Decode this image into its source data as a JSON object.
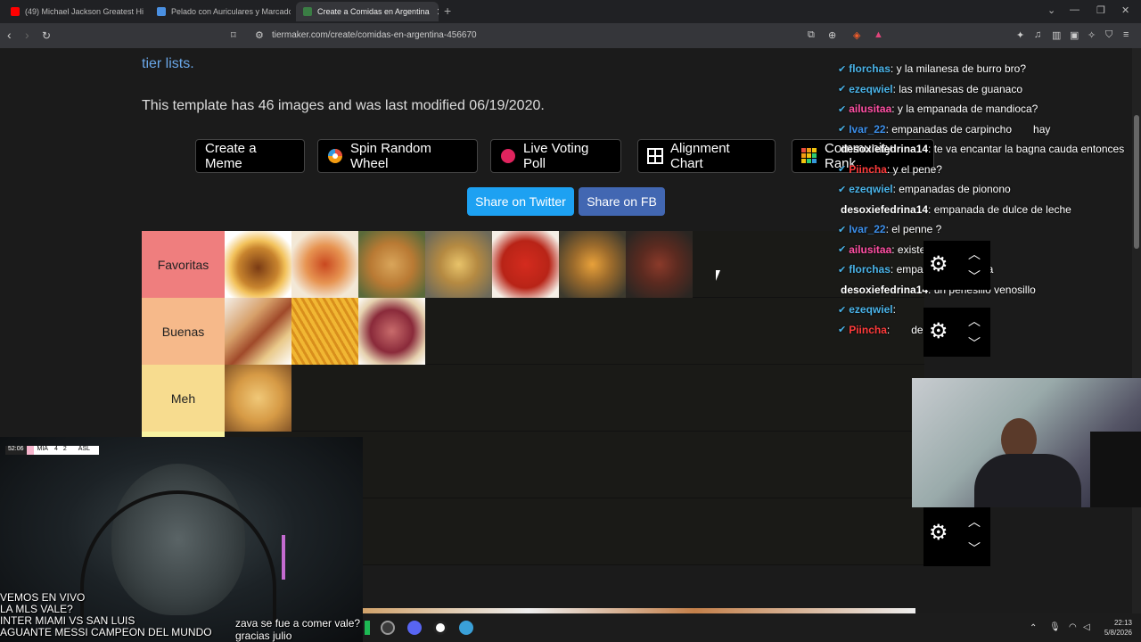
{
  "browser": {
    "tabs": [
      {
        "label": "(49) Michael Jackson Greatest Hi",
        "color": "#ff0000"
      },
      {
        "label": "Pelado con Auriculares y Marcador",
        "color": "#4a90e2"
      },
      {
        "label": "Create a Comidas en Argentina",
        "color": "#3a7d44"
      }
    ],
    "url": "tiermaker.com/create/comidas-en-argentina-456670"
  },
  "page": {
    "tier_lists_link": "tier lists.",
    "template_info": "This template has 46 images and was last modified 06/19/2020.",
    "buttons": [
      "Create a Meme",
      "Spin Random Wheel",
      "Live Voting Poll",
      "Alignment Chart",
      "Community Rank"
    ],
    "share_twitter": "Share on Twitter",
    "share_fb": "Share on FB",
    "tiers": [
      {
        "label": "Favoritas",
        "color": "#ef7e7e",
        "items": [
          "burger",
          "lasagna",
          "empanadas",
          "milanesa",
          "ravioles",
          "tacos",
          "asado"
        ]
      },
      {
        "label": "Buenas",
        "color": "#f6b98a",
        "items": [
          "pancho",
          "papas-fritas",
          "picada"
        ]
      },
      {
        "label": "Meh",
        "color": "#f7dc8f",
        "items": [
          "medialunas"
        ]
      },
      {
        "label": "",
        "color": "#f7f2a0",
        "items": []
      },
      {
        "label": "",
        "color": "#1a1a17",
        "items": []
      }
    ]
  },
  "chat": [
    {
      "user": "florchas",
      "color": "#4ab3e8",
      "text": ": y la milanesa de burro bro?"
    },
    {
      "user": "ezeqwiel",
      "color": "#4ab3e8",
      "text": ": las milanesas de guanaco"
    },
    {
      "user": "ailusitaa",
      "color": "#ff4fa3",
      "text": ": y la empanada de mandioca?"
    },
    {
      "user": "Ivar_22",
      "color": "#3c8ee8",
      "text": ": empanadas de carpincho",
      "extra": "hay"
    },
    {
      "user": "desoxiefedrina14",
      "color": "#ffffff",
      "text": ": te va encantar la bagna cauda entonces"
    },
    {
      "user": "Piincha",
      "color": "#ff3b3b",
      "text": ": y el pene?"
    },
    {
      "user": "ezeqwiel",
      "color": "#4ab3e8",
      "text": ": empanadas de piononо"
    },
    {
      "user": "desoxiefedrina14",
      "color": "#ffffff",
      "text": ": empanada de dulce de leche"
    },
    {
      "user": "Ivar_22",
      "color": "#3c8ee8",
      "text": ": el penne ?"
    },
    {
      "user": "ailusitaa",
      "color": "#ff4fa3",
      "text": ": existe jajjajaja"
    },
    {
      "user": "florchas",
      "color": "#4ab3e8",
      "text": ": empanada de gilada"
    },
    {
      "user": "desoxiefedrina14",
      "color": "#ffffff",
      "text": ": un penesillo venosillo"
    },
    {
      "user": "ezeqwiel",
      "color": "#4ab3e8",
      "text": ":"
    },
    {
      "user": "Piincha",
      "color": "#ff3b3b",
      "text": ":",
      "extra": "de capaz"
    }
  ],
  "stream": {
    "scorebug_time": "52:06",
    "scorebug_home": "MIA",
    "scorebug_score_home": "4",
    "scorebug_score_away": "2",
    "scorebug_away": "ASL",
    "left_text": [
      "VEMOS EN VIVO",
      "LA MLS VALE?",
      "INTER MIAMI VS SAN LUIS",
      "AGUANTE MESSI CAMPEON DEL MUNDO"
    ],
    "bottom_text": [
      "zava se fue a comer vale?",
      "gracias julio"
    ]
  },
  "clock": {
    "time": "22:13",
    "date": "5/8/2026"
  }
}
